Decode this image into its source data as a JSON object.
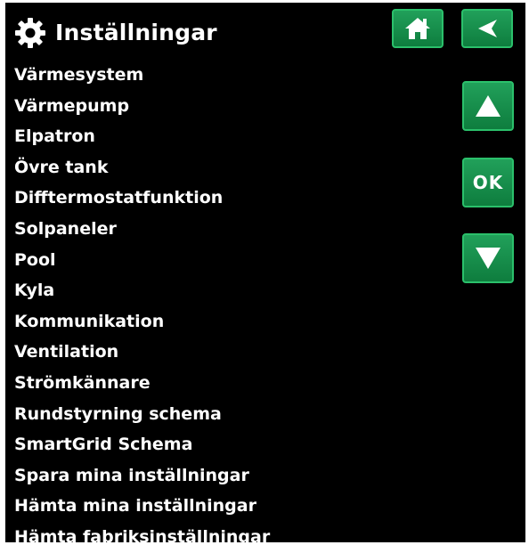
{
  "header": {
    "title": "Inställningar",
    "icon": "gear-icon"
  },
  "menu": {
    "items": [
      {
        "label": "Värmesystem"
      },
      {
        "label": "Värmepump"
      },
      {
        "label": "Elpatron"
      },
      {
        "label": "Övre tank"
      },
      {
        "label": "Difftermostatfunktion"
      },
      {
        "label": "Solpaneler"
      },
      {
        "label": "Pool"
      },
      {
        "label": "Kyla"
      },
      {
        "label": "Kommunikation"
      },
      {
        "label": "Ventilation"
      },
      {
        "label": "Strömkännare"
      },
      {
        "label": "Rundstyrning schema"
      },
      {
        "label": "SmartGrid Schema"
      },
      {
        "label": "Spara mina inställningar"
      },
      {
        "label": "Hämta mina inställningar"
      },
      {
        "label": "Hämta fabriksinställningar"
      }
    ]
  },
  "buttons": {
    "home_icon": "home-icon",
    "back_icon": "back-arrow-icon",
    "up_icon": "up-arrow-icon",
    "ok_label": "OK",
    "down_icon": "down-arrow-icon"
  },
  "colors": {
    "background": "#000000",
    "text": "#ffffff",
    "button": "#149050",
    "button_border": "#2bc06b"
  }
}
